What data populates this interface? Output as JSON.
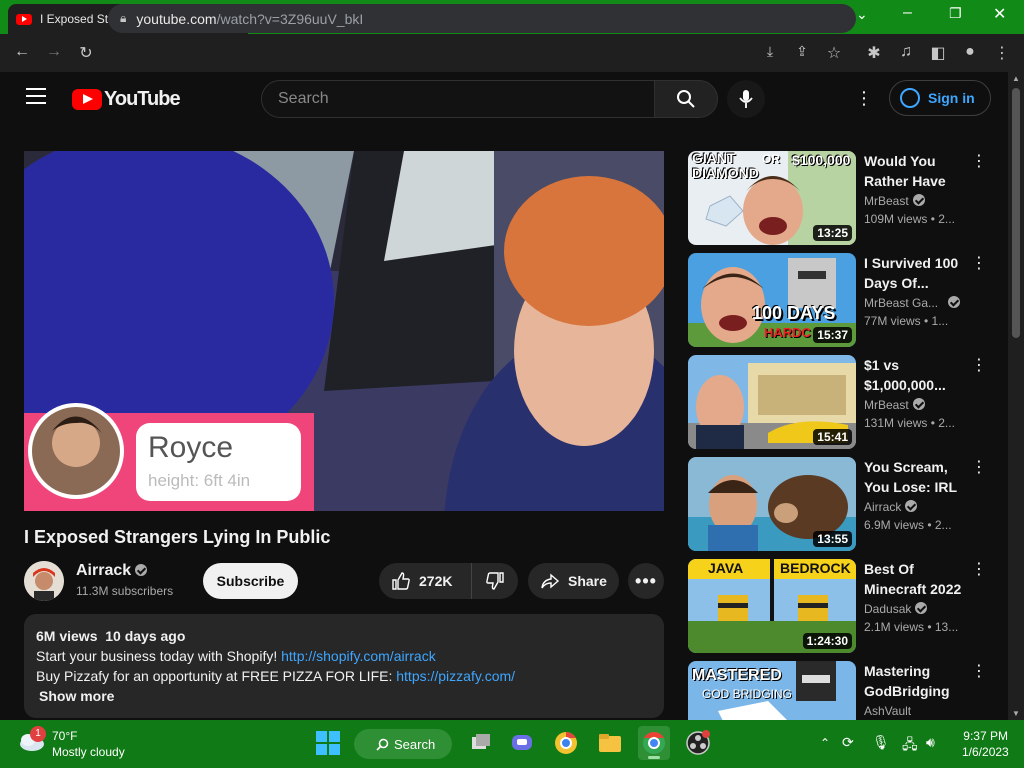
{
  "browser": {
    "tab_title": "I Exposed Strangers Lying In Public",
    "url_host": "youtube.com",
    "url_path": "/watch?v=3Z96uuV_bkI"
  },
  "header": {
    "logo_text": "YouTube",
    "search_placeholder": "Search",
    "sign_in": "Sign in"
  },
  "video": {
    "title": "I Exposed Strangers Lying In Public",
    "channel": "Airrack",
    "subscribers": "11.3M subscribers",
    "subscribe_label": "Subscribe",
    "likes": "272K",
    "share_label": "Share",
    "overlay_name": "Royce",
    "overlay_height": "height: 6ft 4in"
  },
  "description": {
    "meta": "6M views  10 days ago",
    "line1_text": "Start your business today with Shopify! ",
    "line1_link": "http://shopify.com/airrack",
    "line2_text": "Buy Pizzafy for an opportunity at FREE PIZZA FOR LIFE: ",
    "line2_link": "https://pizzafy.com/",
    "show_more": "Show more"
  },
  "recommendations": [
    {
      "title": "Would You Rather Have A...",
      "channel": "MrBeast",
      "views": "109M views  •  2...",
      "duration": "13:25",
      "thumb_text1": "GIANT DIAMOND",
      "thumb_text2": "OR",
      "thumb_text3": "$100,000"
    },
    {
      "title": "I Survived 100 Days Of...",
      "channel": "MrBeast Ga...",
      "views": "77M views  •  1...",
      "duration": "15:37",
      "thumb_text1": "100 DAYS",
      "thumb_text2": "HARDC"
    },
    {
      "title": "$1 vs $1,000,000...",
      "channel": "MrBeast",
      "views": "131M views  •  2...",
      "duration": "15:41"
    },
    {
      "title": "You Scream, You Lose: IRL",
      "channel": "Airrack",
      "views": "6.9M views  •  2...",
      "duration": "13:55"
    },
    {
      "title": "Best Of Minecraft 2022",
      "channel": "Dadusak",
      "views": "2.1M views  •  13...",
      "duration": "1:24:30",
      "thumb_text1": "JAVA",
      "thumb_text2": "BEDROCK"
    },
    {
      "title": "Mastering GodBridging i...",
      "channel": "AshVault",
      "views": "",
      "duration": "",
      "thumb_text1": "MASTERED",
      "thumb_text2": "GOD BRIDGING"
    }
  ],
  "taskbar": {
    "weather_temp": "70°F",
    "weather_desc": "Mostly cloudy",
    "weather_badge": "1",
    "search_label": "Search",
    "time": "9:37 PM",
    "date": "1/6/2023"
  },
  "colors": {
    "chrome_frame": "#118a17",
    "taskbar": "#107a16",
    "yt_red": "#ff0000",
    "link": "#3ea6ff",
    "overlay_pink": "#f0457a"
  }
}
